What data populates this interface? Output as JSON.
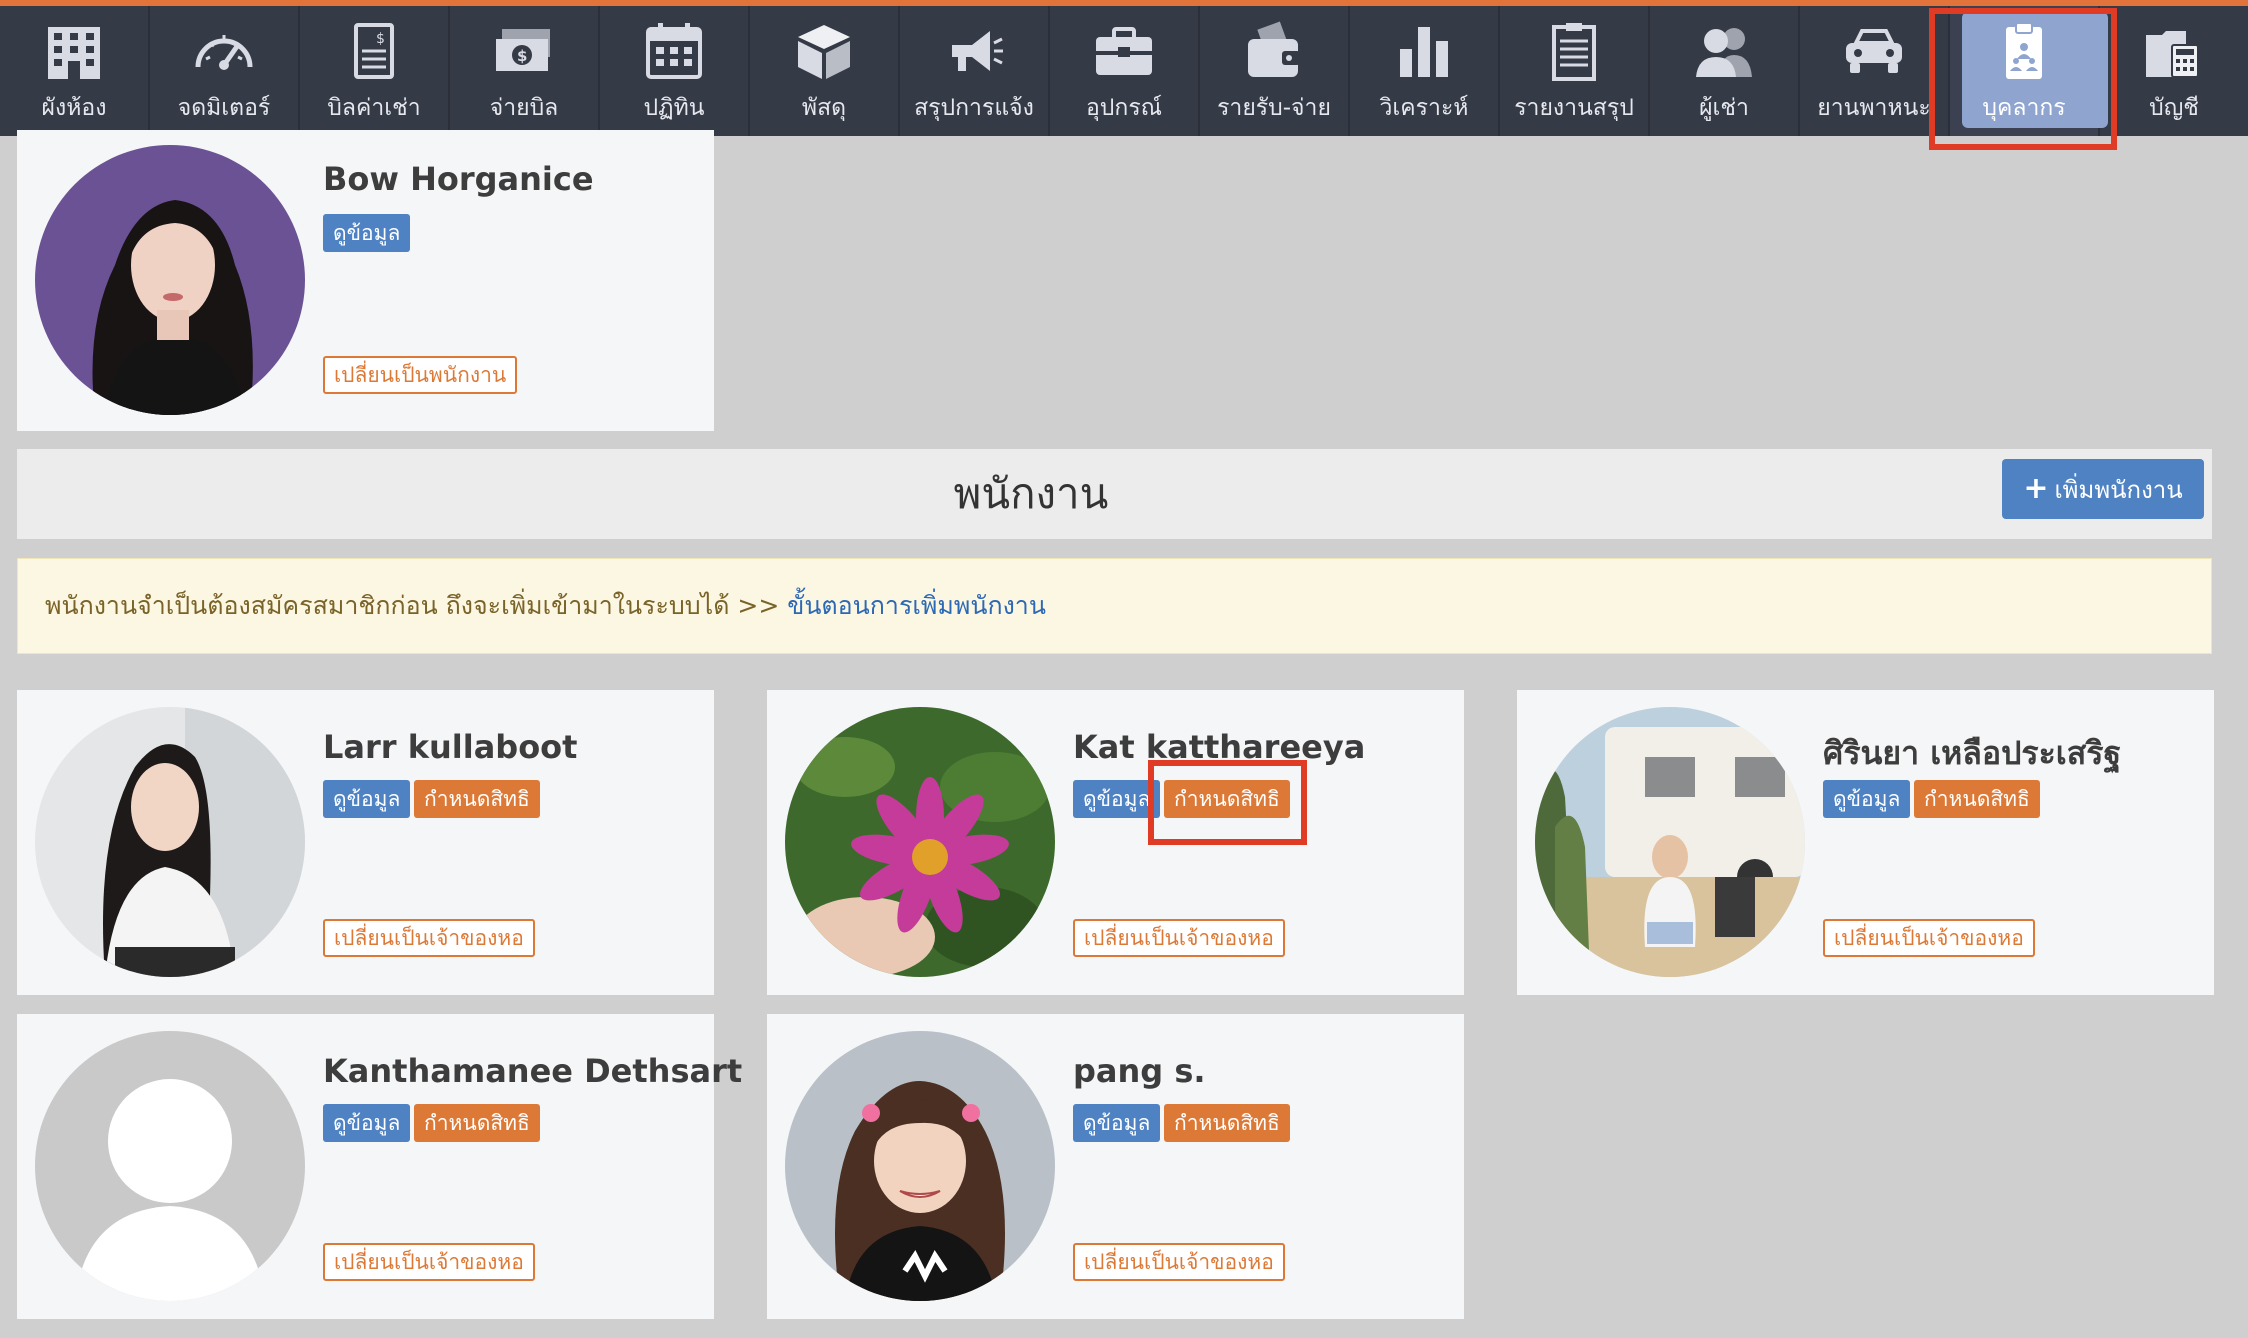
{
  "nav": {
    "items": [
      {
        "label": "ผังห้อง",
        "icon": "building-icon"
      },
      {
        "label": "จดมิเตอร์",
        "icon": "gauge-icon"
      },
      {
        "label": "บิลค่าเช่า",
        "icon": "invoice-icon"
      },
      {
        "label": "จ่ายบิล",
        "icon": "money-icon"
      },
      {
        "label": "ปฏิทิน",
        "icon": "calendar-icon"
      },
      {
        "label": "พัสดุ",
        "icon": "package-icon"
      },
      {
        "label": "สรุปการแจ้ง",
        "icon": "megaphone-icon"
      },
      {
        "label": "อุปกรณ์",
        "icon": "toolbox-icon"
      },
      {
        "label": "รายรับ-จ่าย",
        "icon": "wallet-icon"
      },
      {
        "label": "วิเคราะห์",
        "icon": "bar-chart-icon"
      },
      {
        "label": "รายงานสรุป",
        "icon": "report-icon"
      },
      {
        "label": "ผู้เช่า",
        "icon": "users-icon"
      },
      {
        "label": "ยานพาหนะ",
        "icon": "car-icon"
      },
      {
        "label": "บุคลากร",
        "icon": "staff-clipboard-icon",
        "active": true
      },
      {
        "label": "บัญชี",
        "icon": "accounting-icon"
      }
    ]
  },
  "owner": {
    "name": "Bow Horganice",
    "view_label": "ดูข้อมูล",
    "switch_label": "เปลี่ยนเป็นพนักงาน"
  },
  "staff_section": {
    "title": "พนักงาน",
    "add_label": "เพิ่มพนักงาน",
    "alert_text": "พนักงานจำเป็นต้องสมัครสมาชิกก่อน ถึงจะเพิ่มเข้ามาในระบบได้ >> ",
    "alert_link": "ขั้นตอนการเพิ่มพนักงาน"
  },
  "staff": [
    {
      "name": "Larr kullaboot",
      "view_label": "ดูข้อมูล",
      "perm_label": "กำหนดสิทธิ",
      "switch_label": "เปลี่ยนเป็นเจ้าของหอ"
    },
    {
      "name": "Kat katthareeya",
      "view_label": "ดูข้อมูล",
      "perm_label": "กำหนดสิทธิ",
      "switch_label": "เปลี่ยนเป็นเจ้าของหอ"
    },
    {
      "name": "ศิรินยา เหลือประเสริฐ",
      "view_label": "ดูข้อมูล",
      "perm_label": "กำหนดสิทธิ",
      "switch_label": "เปลี่ยนเป็นเจ้าของหอ"
    },
    {
      "name": "Kanthamanee Dethsart",
      "view_label": "ดูข้อมูล",
      "perm_label": "กำหนดสิทธิ",
      "switch_label": "เปลี่ยนเป็นเจ้าของหอ"
    },
    {
      "name": "pang s.",
      "view_label": "ดูข้อมูล",
      "perm_label": "กำหนดสิทธิ",
      "switch_label": "เปลี่ยนเป็นเจ้าของหอ"
    }
  ],
  "colors": {
    "accent_orange": "#dd7936",
    "primary_blue": "#4e82c3",
    "nav_bg": "#343a46",
    "highlight_red": "#e03b25"
  }
}
